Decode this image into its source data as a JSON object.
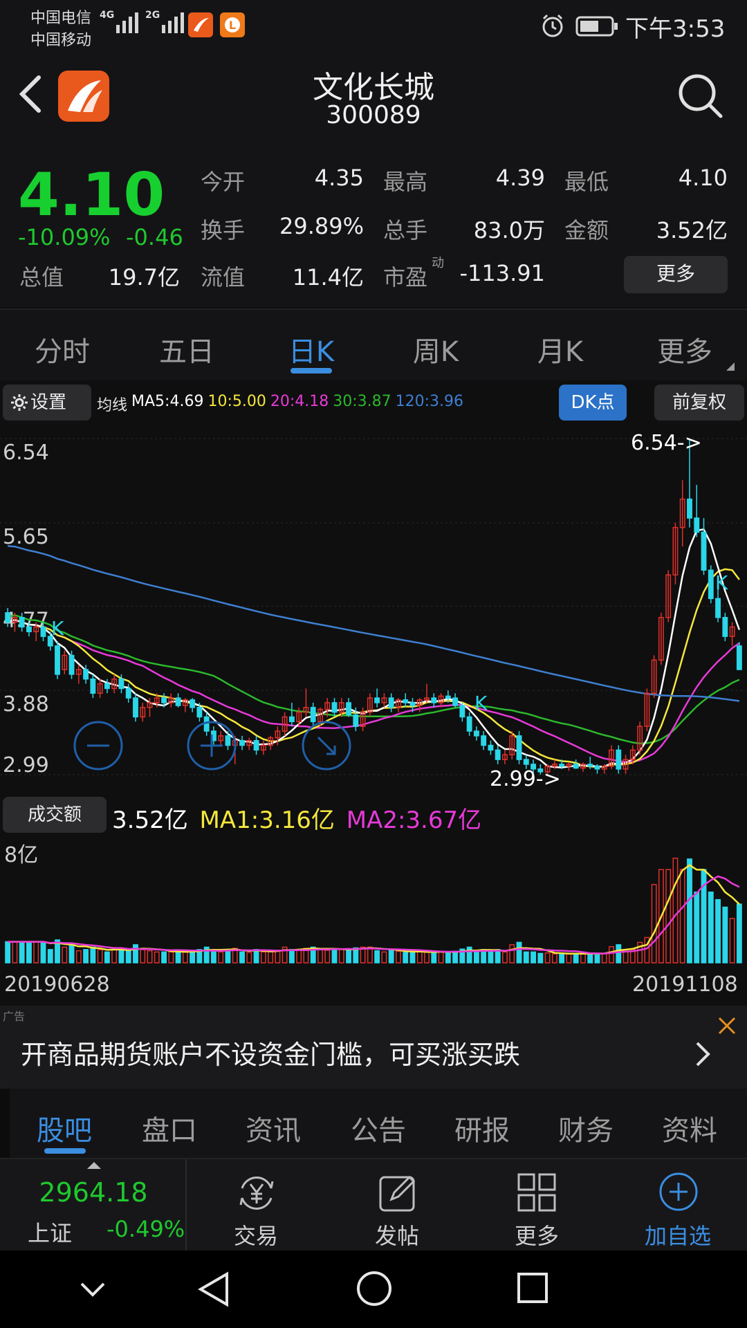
{
  "status": {
    "carrier1": "中国电信",
    "carrier2": "中国移动",
    "net1": "4G",
    "net2": "2G",
    "time": "下午3:53"
  },
  "header": {
    "stock_name": "文化长城",
    "stock_code": "300089"
  },
  "quote": {
    "price": "4.10",
    "change_pct": "-10.09%",
    "change": "-0.46",
    "open_label": "今开",
    "open": "4.35",
    "high_label": "最高",
    "high": "4.39",
    "low_label": "最低",
    "low": "4.10",
    "turnover_label": "换手",
    "turnover": "29.89%",
    "volume_label": "总手",
    "volume": "83.0万",
    "amount_label": "金额",
    "amount": "3.52亿",
    "mktcap_label": "总值",
    "mktcap": "19.7亿",
    "float_label": "流值",
    "float": "11.4亿",
    "pe_label": "市盈",
    "pe_sup": "动",
    "pe": "-113.91",
    "more_button": "更多"
  },
  "chart_tabs": [
    "分时",
    "五日",
    "日K",
    "周K",
    "月K",
    "更多"
  ],
  "active_chart_tab": 2,
  "toolbar": {
    "settings": "设置",
    "ma_prefix": "均线",
    "ma5": "MA5:4.69",
    "ma10": "10:5.00",
    "ma20": "20:4.18",
    "ma30": "30:3.87",
    "ma120": "120:3.96",
    "dk_button": "DK点",
    "adjust_button": "前复权"
  },
  "colors": {
    "up": "#e0312a",
    "down": "#2ad6e8",
    "ma5": "#ffffff",
    "ma10": "#f5e73c",
    "ma20": "#e83ad8",
    "ma30": "#2cb82c",
    "ma120": "#3f7fd0",
    "accent": "#3b8ee0",
    "price_down": "#17d02f"
  },
  "chart_data": {
    "type": "candlestick",
    "y_ticks": [
      "6.54",
      "5.65",
      "4.77",
      "3.88",
      "2.99"
    ],
    "ylim": [
      2.99,
      6.54
    ],
    "max_label": "6.54->",
    "min_label": "2.99->",
    "k_markers": [
      "K",
      "K",
      "K"
    ],
    "candles": [
      [
        4.7,
        4.75,
        4.55,
        4.6
      ],
      [
        4.6,
        4.7,
        4.5,
        4.65
      ],
      [
        4.65,
        4.7,
        4.5,
        4.55
      ],
      [
        4.55,
        4.6,
        4.45,
        4.5
      ],
      [
        4.5,
        4.6,
        4.4,
        4.55
      ],
      [
        4.55,
        4.6,
        4.4,
        4.45
      ],
      [
        4.45,
        4.5,
        4.3,
        4.35
      ],
      [
        4.35,
        4.4,
        4.0,
        4.05
      ],
      [
        4.1,
        4.3,
        4.05,
        4.25
      ],
      [
        4.25,
        4.3,
        4.0,
        4.05
      ],
      [
        4.05,
        4.15,
        3.95,
        4.1
      ],
      [
        4.1,
        4.15,
        3.95,
        4.0
      ],
      [
        4.0,
        4.05,
        3.8,
        3.85
      ],
      [
        3.85,
        4.0,
        3.8,
        3.95
      ],
      [
        3.95,
        4.0,
        3.85,
        3.9
      ],
      [
        3.9,
        4.05,
        3.85,
        4.0
      ],
      [
        4.0,
        4.05,
        3.85,
        3.9
      ],
      [
        3.9,
        3.95,
        3.75,
        3.8
      ],
      [
        3.8,
        3.85,
        3.55,
        3.6
      ],
      [
        3.6,
        3.75,
        3.55,
        3.7
      ],
      [
        3.7,
        3.8,
        3.6,
        3.75
      ],
      [
        3.75,
        3.85,
        3.7,
        3.8
      ],
      [
        3.8,
        3.85,
        3.7,
        3.75
      ],
      [
        3.75,
        3.85,
        3.7,
        3.8
      ],
      [
        3.8,
        3.85,
        3.7,
        3.72
      ],
      [
        3.72,
        3.8,
        3.65,
        3.78
      ],
      [
        3.78,
        3.8,
        3.65,
        3.7
      ],
      [
        3.7,
        3.75,
        3.55,
        3.6
      ],
      [
        3.6,
        3.65,
        3.4,
        3.45
      ],
      [
        3.45,
        3.5,
        3.3,
        3.35
      ],
      [
        3.35,
        3.45,
        3.3,
        3.4
      ],
      [
        3.4,
        3.45,
        3.25,
        3.3
      ],
      [
        3.3,
        3.4,
        3.1,
        3.35
      ],
      [
        3.35,
        3.4,
        3.25,
        3.3
      ],
      [
        3.3,
        3.38,
        3.25,
        3.35
      ],
      [
        3.35,
        3.4,
        3.2,
        3.25
      ],
      [
        3.25,
        3.35,
        3.2,
        3.3
      ],
      [
        3.3,
        3.4,
        3.25,
        3.38
      ],
      [
        3.38,
        3.5,
        3.3,
        3.45
      ],
      [
        3.45,
        3.65,
        3.4,
        3.6
      ],
      [
        3.6,
        3.75,
        3.5,
        3.55
      ],
      [
        3.55,
        3.7,
        3.5,
        3.65
      ],
      [
        3.65,
        3.9,
        3.6,
        3.7
      ],
      [
        3.7,
        3.75,
        3.5,
        3.55
      ],
      [
        3.55,
        3.7,
        3.5,
        3.68
      ],
      [
        3.68,
        3.8,
        3.6,
        3.75
      ],
      [
        3.75,
        3.8,
        3.6,
        3.65
      ],
      [
        3.65,
        3.8,
        3.6,
        3.75
      ],
      [
        3.75,
        3.8,
        3.6,
        3.62
      ],
      [
        3.62,
        3.7,
        3.45,
        3.5
      ],
      [
        3.5,
        3.7,
        3.45,
        3.65
      ],
      [
        3.65,
        3.85,
        3.6,
        3.8
      ],
      [
        3.8,
        3.9,
        3.7,
        3.75
      ],
      [
        3.75,
        3.85,
        3.7,
        3.8
      ],
      [
        3.8,
        3.85,
        3.65,
        3.7
      ],
      [
        3.7,
        3.8,
        3.65,
        3.78
      ],
      [
        3.78,
        3.85,
        3.7,
        3.75
      ],
      [
        3.75,
        3.8,
        3.65,
        3.72
      ],
      [
        3.72,
        3.8,
        3.65,
        3.78
      ],
      [
        3.78,
        3.95,
        3.75,
        3.8
      ],
      [
        3.8,
        3.85,
        3.7,
        3.75
      ],
      [
        3.75,
        3.85,
        3.7,
        3.82
      ],
      [
        3.82,
        3.88,
        3.75,
        3.8
      ],
      [
        3.8,
        3.85,
        3.7,
        3.72
      ],
      [
        3.72,
        3.75,
        3.55,
        3.6
      ],
      [
        3.6,
        3.65,
        3.4,
        3.45
      ],
      [
        3.45,
        3.5,
        3.35,
        3.4
      ],
      [
        3.4,
        3.45,
        3.25,
        3.3
      ],
      [
        3.3,
        3.35,
        3.2,
        3.25
      ],
      [
        3.25,
        3.3,
        3.1,
        3.15
      ],
      [
        3.15,
        3.25,
        3.1,
        3.2
      ],
      [
        3.2,
        3.45,
        3.15,
        3.4
      ],
      [
        3.4,
        3.45,
        3.1,
        3.15
      ],
      [
        3.15,
        3.2,
        3.05,
        3.1
      ],
      [
        3.1,
        3.15,
        3.0,
        3.05
      ],
      [
        3.05,
        3.1,
        2.99,
        3.02
      ],
      [
        3.02,
        3.1,
        3.0,
        3.08
      ],
      [
        3.08,
        3.15,
        3.05,
        3.1
      ],
      [
        3.1,
        3.15,
        3.05,
        3.08
      ],
      [
        3.08,
        3.12,
        3.03,
        3.1
      ],
      [
        3.1,
        3.15,
        3.05,
        3.06
      ],
      [
        3.06,
        3.12,
        3.02,
        3.1
      ],
      [
        3.1,
        3.18,
        3.05,
        3.08
      ],
      [
        3.08,
        3.1,
        3.0,
        3.05
      ],
      [
        3.05,
        3.1,
        3.0,
        3.08
      ],
      [
        3.08,
        3.3,
        3.05,
        3.25
      ],
      [
        3.25,
        3.3,
        3.0,
        3.05
      ],
      [
        3.05,
        3.2,
        3.0,
        3.15
      ],
      [
        3.15,
        3.3,
        3.1,
        3.25
      ],
      [
        3.25,
        3.55,
        3.2,
        3.5
      ],
      [
        3.5,
        3.9,
        3.45,
        3.85
      ],
      [
        3.85,
        4.25,
        3.8,
        4.2
      ],
      [
        4.2,
        4.7,
        4.15,
        4.65
      ],
      [
        4.65,
        5.15,
        4.6,
        5.1
      ],
      [
        5.1,
        5.65,
        5.0,
        5.6
      ],
      [
        5.6,
        6.1,
        5.4,
        5.9
      ],
      [
        5.9,
        6.54,
        5.6,
        5.7
      ],
      [
        5.7,
        6.05,
        5.5,
        5.55
      ],
      [
        5.55,
        5.7,
        5.1,
        5.15
      ],
      [
        5.15,
        5.2,
        4.8,
        4.85
      ],
      [
        4.85,
        5.0,
        4.6,
        4.65
      ],
      [
        4.65,
        4.7,
        4.4,
        4.45
      ],
      [
        4.45,
        4.6,
        4.35,
        4.55
      ],
      [
        4.35,
        4.39,
        4.1,
        4.1
      ]
    ],
    "vol_label": "成交额",
    "vol_value": "3.52亿",
    "vol_ma1": "MA1:3.16亿",
    "vol_ma2": "MA2:3.67亿",
    "vol_axis": "8亿",
    "vol_ylim": [
      0,
      8
    ],
    "start_date": "20190628",
    "end_date": "20191108"
  },
  "ad": {
    "tag": "广告",
    "text": "开商品期货账户不设资金门槛，可买涨买跌"
  },
  "bottom_tabs": [
    "股吧",
    "盘口",
    "资讯",
    "公告",
    "研报",
    "财务",
    "资料"
  ],
  "index": {
    "value": "2964.18",
    "name": "上证",
    "change": "-0.49%"
  },
  "nav": {
    "trade": "交易",
    "post": "发帖",
    "more": "更多",
    "add": "加自选"
  }
}
